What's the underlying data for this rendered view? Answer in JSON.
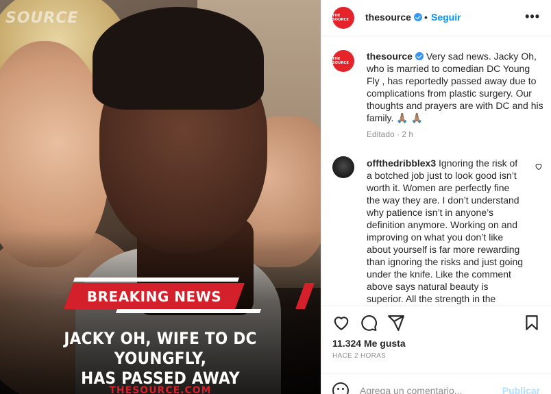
{
  "image": {
    "watermark": "SOURCE",
    "badge": "BREAKING NEWS",
    "headline_lines": [
      "JACKY OH, WIFE TO DC YOUNGFLY,",
      "HAS PASSED AWAY"
    ],
    "site": "THESOURCE.COM"
  },
  "header": {
    "avatar_text": "THE SOURCE",
    "username": "thesource",
    "dot": "•",
    "follow_label": "Seguir",
    "more_label": "•••"
  },
  "caption": {
    "avatar_text": "THE SOURCE",
    "username": "thesource",
    "text": "Very sad news. Jacky Oh, who is married to comedian DC Young Fly , has reportedly passed away due to complications from plastic surgery. Our thoughts and prayers are with DC and his family. 🙏🏽 🙏🏽",
    "edited": "Editado",
    "dot": "·",
    "age": "2 h"
  },
  "comment": {
    "username": "offthedribblex3",
    "text": "Ignoring the risk of a botched job just to look good isn’t worth it. Women are perfectly fine the way they are. I don’t understand why patience isn’t in anyone’s definition anymore. Working on and improving on what you don’t like about yourself is far more rewarding than ignoring the risks and just going under the knife. Like the comment above says natural beauty is superior. All the strength in the"
  },
  "actions": {
    "likes": "11.324 Me gusta",
    "time": "HACE 2 HORAS"
  },
  "add_comment": {
    "placeholder": "Agrega un comentario...",
    "post_label": "Publicar"
  },
  "colors": {
    "accent_blue": "#0095f6",
    "brand_red": "#e4232b",
    "breaking_red": "#d4202a"
  }
}
